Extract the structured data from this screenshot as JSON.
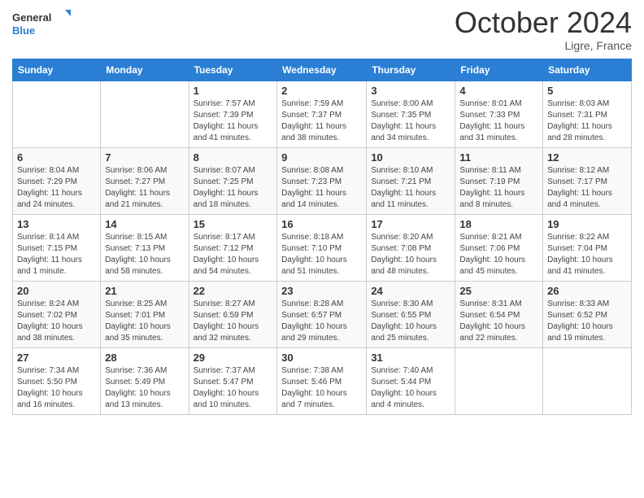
{
  "logo": {
    "text_general": "General",
    "text_blue": "Blue"
  },
  "header": {
    "month_year": "October 2024",
    "location": "Ligre, France"
  },
  "days_of_week": [
    "Sunday",
    "Monday",
    "Tuesday",
    "Wednesday",
    "Thursday",
    "Friday",
    "Saturday"
  ],
  "weeks": [
    [
      {
        "day": "",
        "info": ""
      },
      {
        "day": "",
        "info": ""
      },
      {
        "day": "1",
        "info": "Sunrise: 7:57 AM\nSunset: 7:39 PM\nDaylight: 11 hours and 41 minutes."
      },
      {
        "day": "2",
        "info": "Sunrise: 7:59 AM\nSunset: 7:37 PM\nDaylight: 11 hours and 38 minutes."
      },
      {
        "day": "3",
        "info": "Sunrise: 8:00 AM\nSunset: 7:35 PM\nDaylight: 11 hours and 34 minutes."
      },
      {
        "day": "4",
        "info": "Sunrise: 8:01 AM\nSunset: 7:33 PM\nDaylight: 11 hours and 31 minutes."
      },
      {
        "day": "5",
        "info": "Sunrise: 8:03 AM\nSunset: 7:31 PM\nDaylight: 11 hours and 28 minutes."
      }
    ],
    [
      {
        "day": "6",
        "info": "Sunrise: 8:04 AM\nSunset: 7:29 PM\nDaylight: 11 hours and 24 minutes."
      },
      {
        "day": "7",
        "info": "Sunrise: 8:06 AM\nSunset: 7:27 PM\nDaylight: 11 hours and 21 minutes."
      },
      {
        "day": "8",
        "info": "Sunrise: 8:07 AM\nSunset: 7:25 PM\nDaylight: 11 hours and 18 minutes."
      },
      {
        "day": "9",
        "info": "Sunrise: 8:08 AM\nSunset: 7:23 PM\nDaylight: 11 hours and 14 minutes."
      },
      {
        "day": "10",
        "info": "Sunrise: 8:10 AM\nSunset: 7:21 PM\nDaylight: 11 hours and 11 minutes."
      },
      {
        "day": "11",
        "info": "Sunrise: 8:11 AM\nSunset: 7:19 PM\nDaylight: 11 hours and 8 minutes."
      },
      {
        "day": "12",
        "info": "Sunrise: 8:12 AM\nSunset: 7:17 PM\nDaylight: 11 hours and 4 minutes."
      }
    ],
    [
      {
        "day": "13",
        "info": "Sunrise: 8:14 AM\nSunset: 7:15 PM\nDaylight: 11 hours and 1 minute."
      },
      {
        "day": "14",
        "info": "Sunrise: 8:15 AM\nSunset: 7:13 PM\nDaylight: 10 hours and 58 minutes."
      },
      {
        "day": "15",
        "info": "Sunrise: 8:17 AM\nSunset: 7:12 PM\nDaylight: 10 hours and 54 minutes."
      },
      {
        "day": "16",
        "info": "Sunrise: 8:18 AM\nSunset: 7:10 PM\nDaylight: 10 hours and 51 minutes."
      },
      {
        "day": "17",
        "info": "Sunrise: 8:20 AM\nSunset: 7:08 PM\nDaylight: 10 hours and 48 minutes."
      },
      {
        "day": "18",
        "info": "Sunrise: 8:21 AM\nSunset: 7:06 PM\nDaylight: 10 hours and 45 minutes."
      },
      {
        "day": "19",
        "info": "Sunrise: 8:22 AM\nSunset: 7:04 PM\nDaylight: 10 hours and 41 minutes."
      }
    ],
    [
      {
        "day": "20",
        "info": "Sunrise: 8:24 AM\nSunset: 7:02 PM\nDaylight: 10 hours and 38 minutes."
      },
      {
        "day": "21",
        "info": "Sunrise: 8:25 AM\nSunset: 7:01 PM\nDaylight: 10 hours and 35 minutes."
      },
      {
        "day": "22",
        "info": "Sunrise: 8:27 AM\nSunset: 6:59 PM\nDaylight: 10 hours and 32 minutes."
      },
      {
        "day": "23",
        "info": "Sunrise: 8:28 AM\nSunset: 6:57 PM\nDaylight: 10 hours and 29 minutes."
      },
      {
        "day": "24",
        "info": "Sunrise: 8:30 AM\nSunset: 6:55 PM\nDaylight: 10 hours and 25 minutes."
      },
      {
        "day": "25",
        "info": "Sunrise: 8:31 AM\nSunset: 6:54 PM\nDaylight: 10 hours and 22 minutes."
      },
      {
        "day": "26",
        "info": "Sunrise: 8:33 AM\nSunset: 6:52 PM\nDaylight: 10 hours and 19 minutes."
      }
    ],
    [
      {
        "day": "27",
        "info": "Sunrise: 7:34 AM\nSunset: 5:50 PM\nDaylight: 10 hours and 16 minutes."
      },
      {
        "day": "28",
        "info": "Sunrise: 7:36 AM\nSunset: 5:49 PM\nDaylight: 10 hours and 13 minutes."
      },
      {
        "day": "29",
        "info": "Sunrise: 7:37 AM\nSunset: 5:47 PM\nDaylight: 10 hours and 10 minutes."
      },
      {
        "day": "30",
        "info": "Sunrise: 7:38 AM\nSunset: 5:46 PM\nDaylight: 10 hours and 7 minutes."
      },
      {
        "day": "31",
        "info": "Sunrise: 7:40 AM\nSunset: 5:44 PM\nDaylight: 10 hours and 4 minutes."
      },
      {
        "day": "",
        "info": ""
      },
      {
        "day": "",
        "info": ""
      }
    ]
  ]
}
